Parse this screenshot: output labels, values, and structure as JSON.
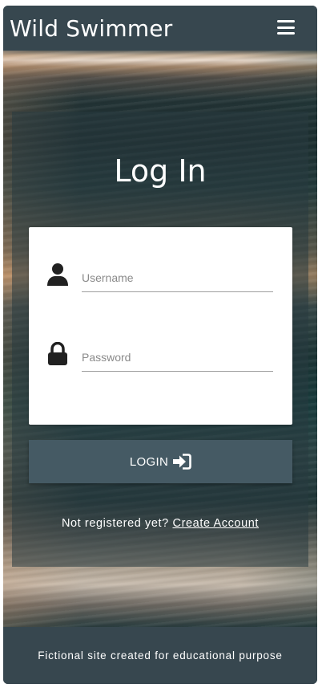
{
  "header": {
    "brand": "Wild Swimmer",
    "menu_icon": "hamburger-menu-icon"
  },
  "login": {
    "title": "Log In",
    "username": {
      "placeholder": "Username",
      "value": "",
      "icon": "user-icon"
    },
    "password": {
      "placeholder": "Password",
      "value": "",
      "icon": "lock-icon"
    },
    "submit_label": "LOGIN",
    "submit_icon": "sign-in-icon",
    "register_prompt": "Not registered yet?",
    "register_link": "Create Account"
  },
  "footer": {
    "text": "Fictional site created for educational purpose"
  },
  "colors": {
    "header_bg": "#37474f",
    "button_bg": "#455a64",
    "card_bg": "#ffffff"
  }
}
